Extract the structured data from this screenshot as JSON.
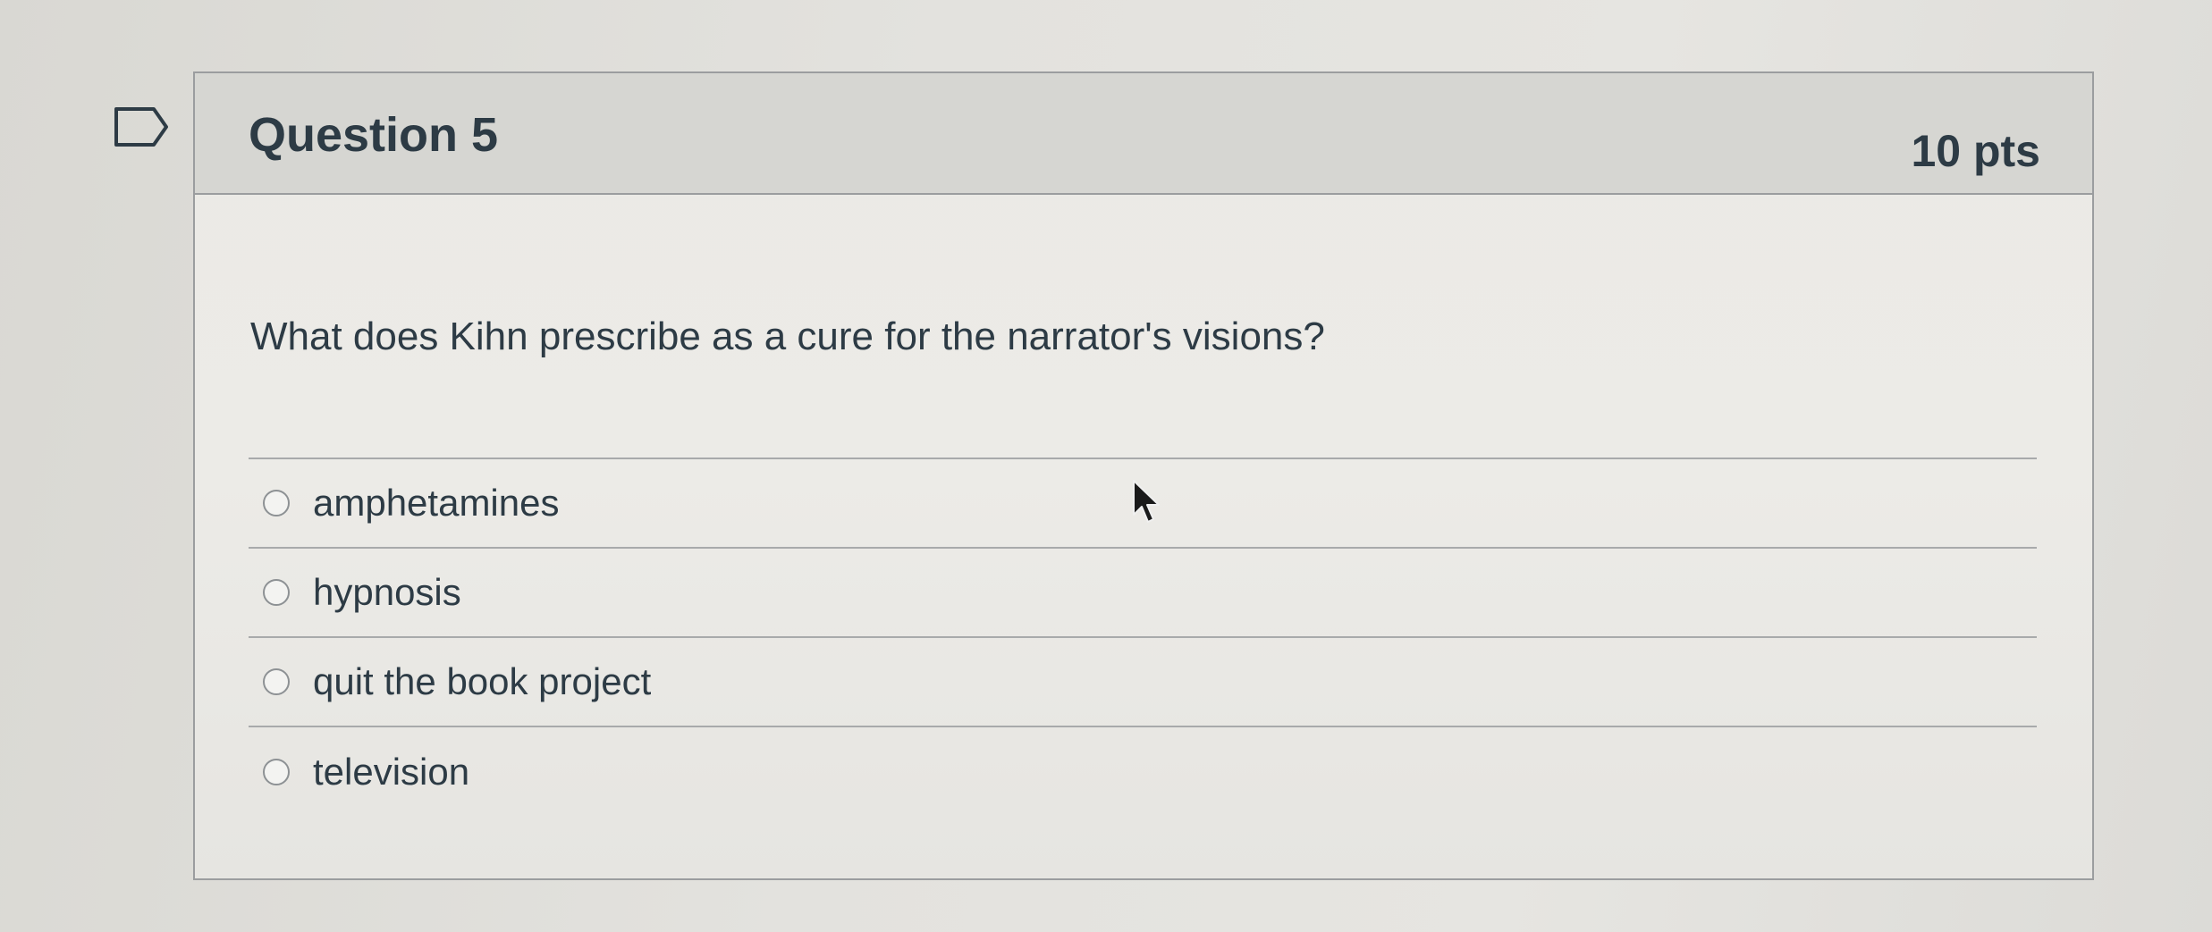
{
  "question": {
    "title": "Question 5",
    "points": "10 pts",
    "text": "What does Kihn prescribe as a cure for the narrator's visions?",
    "answers": [
      {
        "label": "amphetamines"
      },
      {
        "label": "hypnosis"
      },
      {
        "label": "quit the book project"
      },
      {
        "label": "television"
      }
    ]
  },
  "icons": {
    "flag": "flag-icon",
    "cursor": "mouse-cursor-icon",
    "radio": "radio-button-icon"
  },
  "colors": {
    "text": "#2d3b45",
    "header_background": "#d6d6d2",
    "border": "#9b9d9f"
  }
}
